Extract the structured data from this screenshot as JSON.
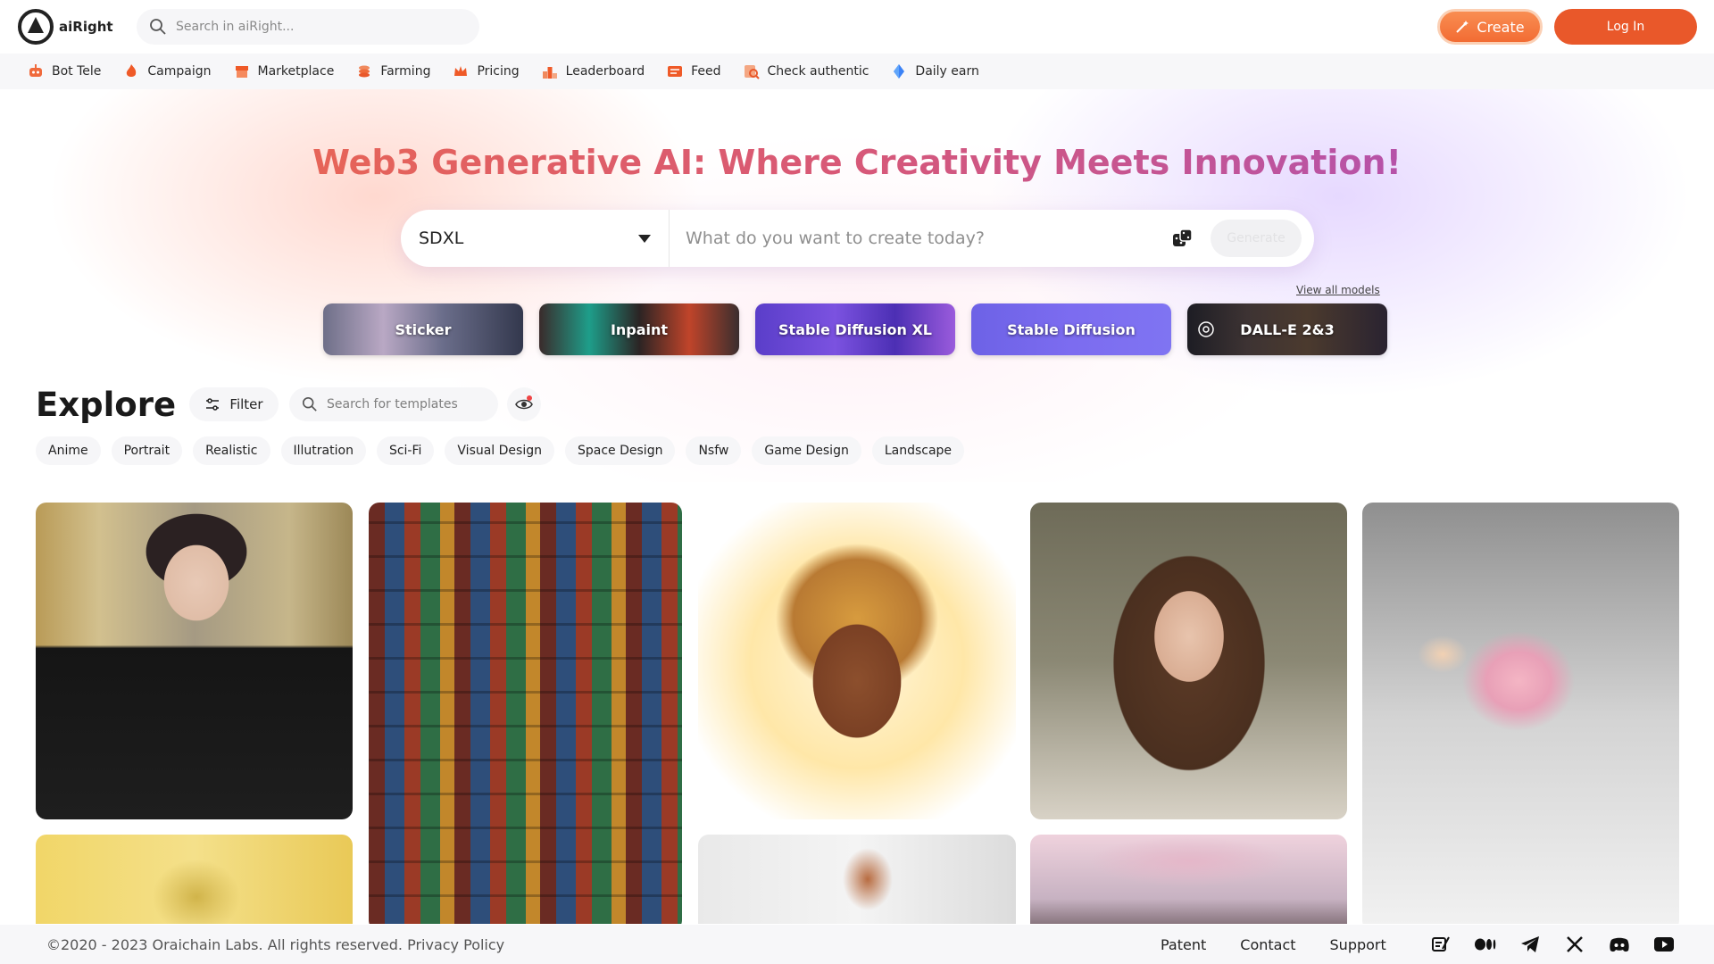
{
  "brand": {
    "name": "aiRight"
  },
  "header": {
    "search_placeholder": "Search in aiRight...",
    "create_label": "Create",
    "login_label": "Log In"
  },
  "nav": {
    "items": [
      {
        "label": "Bot Tele",
        "icon": "robot-icon"
      },
      {
        "label": "Campaign",
        "icon": "fire-icon"
      },
      {
        "label": "Marketplace",
        "icon": "store-icon"
      },
      {
        "label": "Farming",
        "icon": "coins-icon"
      },
      {
        "label": "Pricing",
        "icon": "crown-icon"
      },
      {
        "label": "Leaderboard",
        "icon": "podium-icon"
      },
      {
        "label": "Feed",
        "icon": "news-icon"
      },
      {
        "label": "Check authentic",
        "icon": "magnifier-icon"
      },
      {
        "label": "Daily earn",
        "icon": "diamond-icon"
      }
    ]
  },
  "hero": {
    "headline": "Web3 Generative AI: Where Creativity Meets Innovation!",
    "model_selected": "SDXL",
    "prompt_placeholder": "What do you want to create today?",
    "generate_label": "Generate",
    "view_all_models": "View all models",
    "models": [
      "Sticker",
      "Inpaint",
      "Stable Diffusion XL",
      "Stable Diffusion",
      "DALL-E 2&3"
    ]
  },
  "explore": {
    "title": "Explore",
    "filter_label": "Filter",
    "template_search_placeholder": "Search for templates",
    "categories": [
      "Anime",
      "Portrait",
      "Realistic",
      "Illutration",
      "Sci-Fi",
      "Visual Design",
      "Space Design",
      "Nsfw",
      "Game Design",
      "Landscape"
    ]
  },
  "footer": {
    "copyright": "©2020 - 2023 Oraichain Labs. All rights reserved. Privacy Policy",
    "links": [
      "Patent",
      "Contact",
      "Support"
    ],
    "social_icons": [
      "blog-icon",
      "medium-icon",
      "telegram-icon",
      "x-icon",
      "discord-icon",
      "youtube-icon"
    ]
  },
  "colors": {
    "accent": "#e9582a",
    "create_gradient_start": "#f98e52",
    "headline_start": "#ef6b45",
    "headline_end": "#a34fc5"
  }
}
